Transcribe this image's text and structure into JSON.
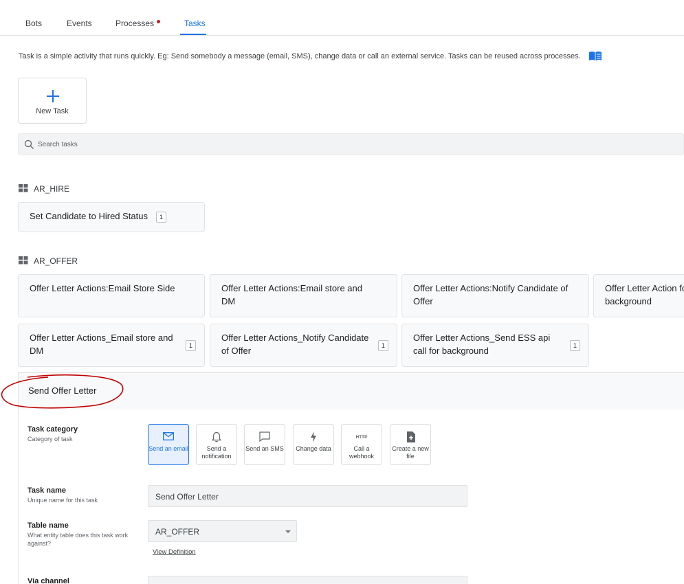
{
  "tabs": [
    {
      "label": "Bots"
    },
    {
      "label": "Events"
    },
    {
      "label": "Processes"
    },
    {
      "label": "Tasks"
    }
  ],
  "info_text": "Task is a simple activity that runs quickly. Eg: Send somebody a message (email, SMS), change data or call an external service. Tasks can be reused across processes.",
  "new_task_label": "New Task",
  "search": {
    "placeholder": "Search tasks"
  },
  "groups": [
    {
      "name": "AR_HIRE",
      "tasks": [
        {
          "label": "Set Candidate to Hired Status",
          "count": "1"
        }
      ]
    },
    {
      "name": "AR_OFFER",
      "tasks": [
        {
          "label": "Offer Letter Actions:Email Store Side"
        },
        {
          "label": "Offer Letter Actions:Email store and DM"
        },
        {
          "label": "Offer Letter Actions:Notify Candidate of Offer"
        },
        {
          "label": "Offer Letter Action for background"
        },
        {
          "label": "Offer Letter Actions_Email store and DM",
          "count": "1"
        },
        {
          "label": "Offer Letter Actions_Notify Candidate of Offer",
          "count": "1"
        },
        {
          "label": "Offer Letter Actions_Send ESS api call for background",
          "count": "1"
        }
      ]
    }
  ],
  "form": {
    "title": "Send Offer Letter",
    "task_category": {
      "label": "Task category",
      "sub": "Category of task",
      "options": [
        {
          "label": "Send an email",
          "icon": "mail-icon",
          "selected": true
        },
        {
          "label": "Send a notification",
          "icon": "bell-icon",
          "selected": false
        },
        {
          "label": "Send an SMS",
          "icon": "chat-icon",
          "selected": false
        },
        {
          "label": "Change data",
          "icon": "bolt-icon",
          "selected": false
        },
        {
          "label": "Call a webhook",
          "icon": "http-icon",
          "selected": false
        },
        {
          "label": "Create a new file",
          "icon": "file-add-icon",
          "selected": false
        }
      ]
    },
    "task_name": {
      "label": "Task name",
      "sub": "Unique name for this task",
      "value": "Send Offer Letter"
    },
    "table_name": {
      "label": "Table name",
      "sub": "What entity table does this task work against?",
      "value": "AR_OFFER",
      "link": "View Definition"
    },
    "via_channel": {
      "label": "Via channel"
    }
  },
  "colors": {
    "accent": "#1a73e8",
    "dot": "#c5221f",
    "annotation": "#c00000"
  }
}
